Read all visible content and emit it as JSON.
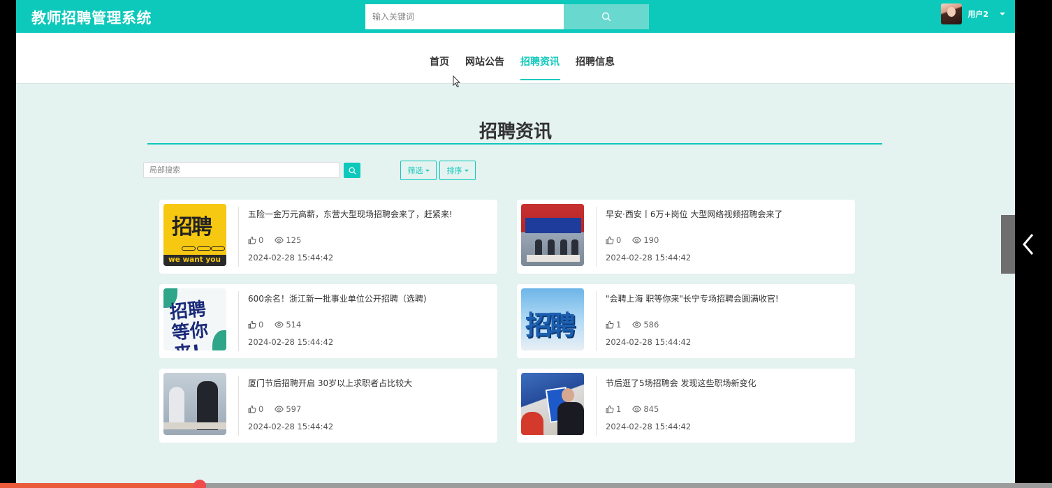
{
  "app": {
    "title": "教师招聘管理系统"
  },
  "header": {
    "search_placeholder": "输入关键词",
    "user_name": "用户2"
  },
  "nav": {
    "items": [
      {
        "label": "首页",
        "active": false
      },
      {
        "label": "网站公告",
        "active": false
      },
      {
        "label": "招聘资讯",
        "active": true
      },
      {
        "label": "招聘信息",
        "active": false
      }
    ]
  },
  "main": {
    "title": "招聘资讯",
    "local_search_placeholder": "局部搜索",
    "filter_label": "筛选",
    "sort_label": "排序",
    "articles": [
      {
        "title": "五险一金万元高薪，东营大型现场招聘会来了，赶紧来!",
        "likes": "0",
        "views": "125",
        "date": "2024-02-28 15:44:42",
        "thumb_text": "招聘",
        "thumb_band": "we want you"
      },
      {
        "title": "早安·西安丨6万+岗位 大型网络视频招聘会来了",
        "likes": "0",
        "views": "190",
        "date": "2024-02-28 15:44:42"
      },
      {
        "title": "600余名！浙江新一批事业单位公开招聘（选聘)",
        "likes": "0",
        "views": "514",
        "date": "2024-02-28 15:44:42",
        "thumb_text": "招聘\n等你来!"
      },
      {
        "title": "\"会聘上海 职等你来\"长宁专场招聘会圆满收官!",
        "likes": "1",
        "views": "586",
        "date": "2024-02-28 15:44:42",
        "thumb_text": "招聘"
      },
      {
        "title": "厦门节后招聘开启 30岁以上求职者占比较大",
        "likes": "0",
        "views": "597",
        "date": "2024-02-28 15:44:42"
      },
      {
        "title": "节后逛了5场招聘会 发现这些职场新变化",
        "likes": "1",
        "views": "845",
        "date": "2024-02-28 15:44:42"
      }
    ]
  },
  "player": {
    "progress": 0.19
  },
  "colors": {
    "accent": "#0cc9bb",
    "background": "#e4f2f0",
    "progress": "#ea5a3b"
  }
}
